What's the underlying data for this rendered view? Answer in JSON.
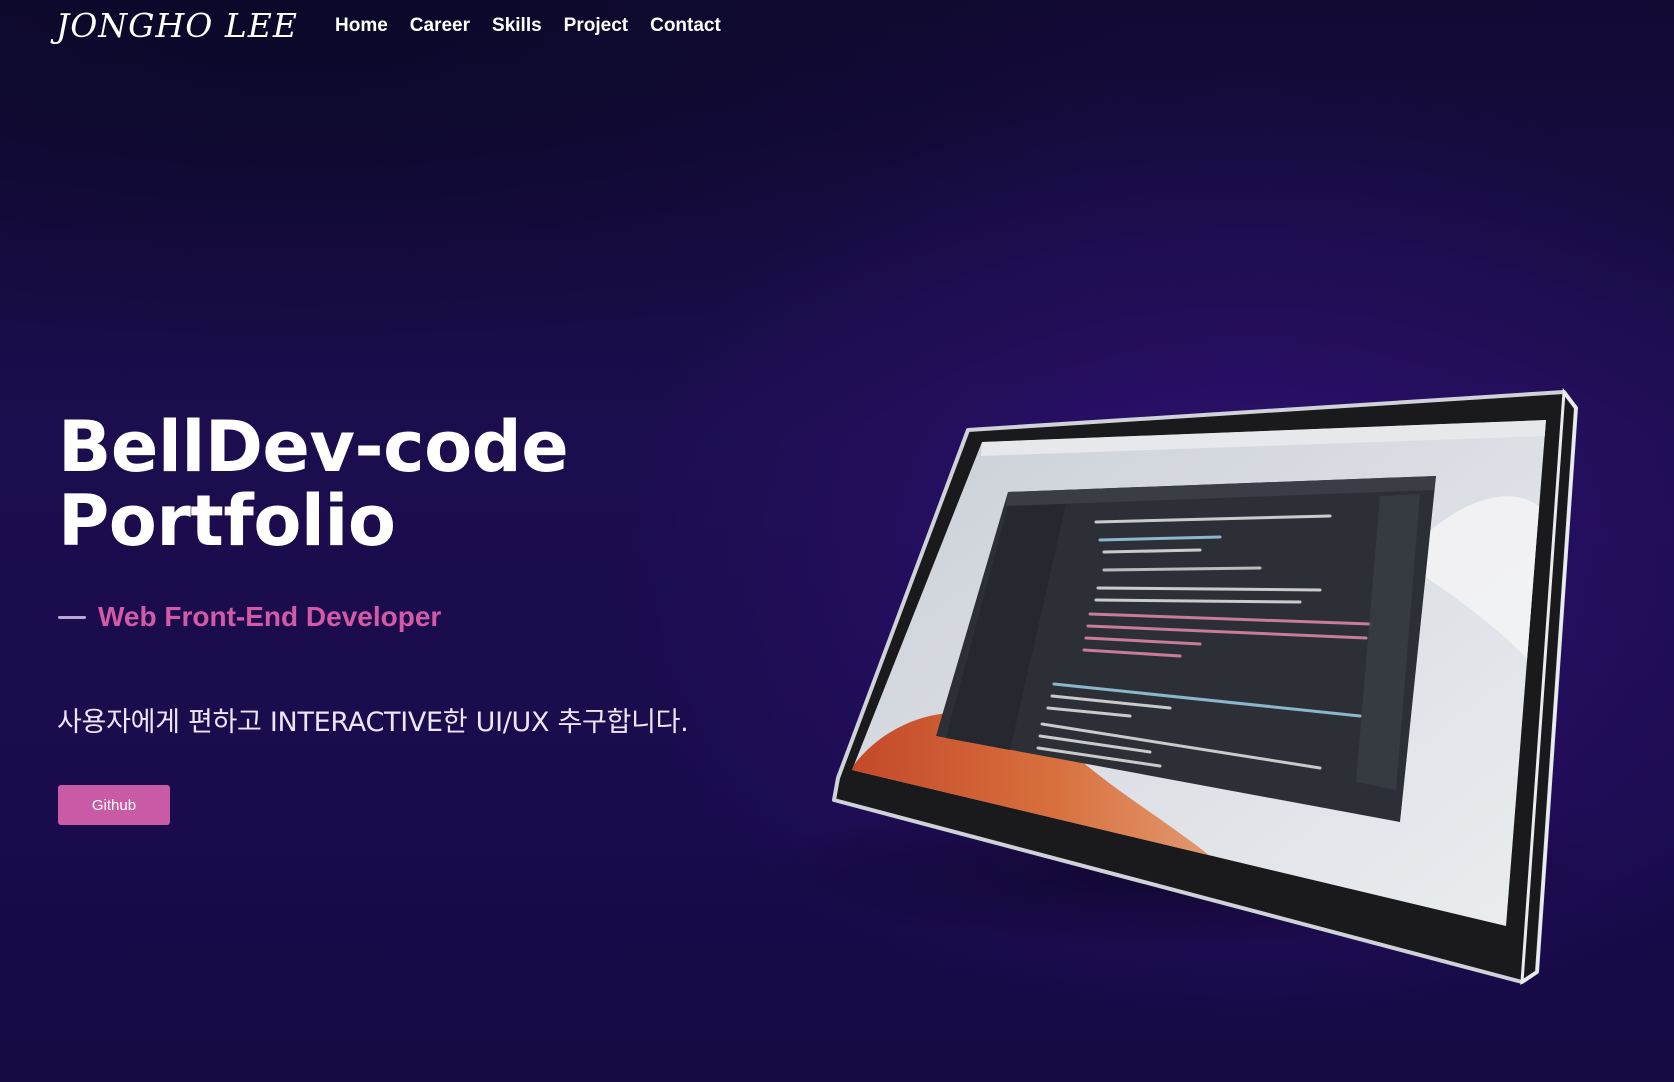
{
  "header": {
    "logo": "JONGHO LEE",
    "nav": [
      {
        "label": "Home"
      },
      {
        "label": "Career"
      },
      {
        "label": "Skills"
      },
      {
        "label": "Project"
      },
      {
        "label": "Contact"
      }
    ]
  },
  "hero": {
    "title_line1": "BellDev-code",
    "title_line2": "Portfolio",
    "subtitle": "Web Front-End Developer",
    "tagline": "사용자에게 편하고 INTERACTIVE한 UI/UX 추구합니다.",
    "button_label": "Github"
  },
  "colors": {
    "background": "#1a0b4d",
    "accent": "#c85aa6",
    "subtitle": "#d35aa6"
  },
  "device": {
    "type": "tablet",
    "screen_content": "code editor"
  }
}
